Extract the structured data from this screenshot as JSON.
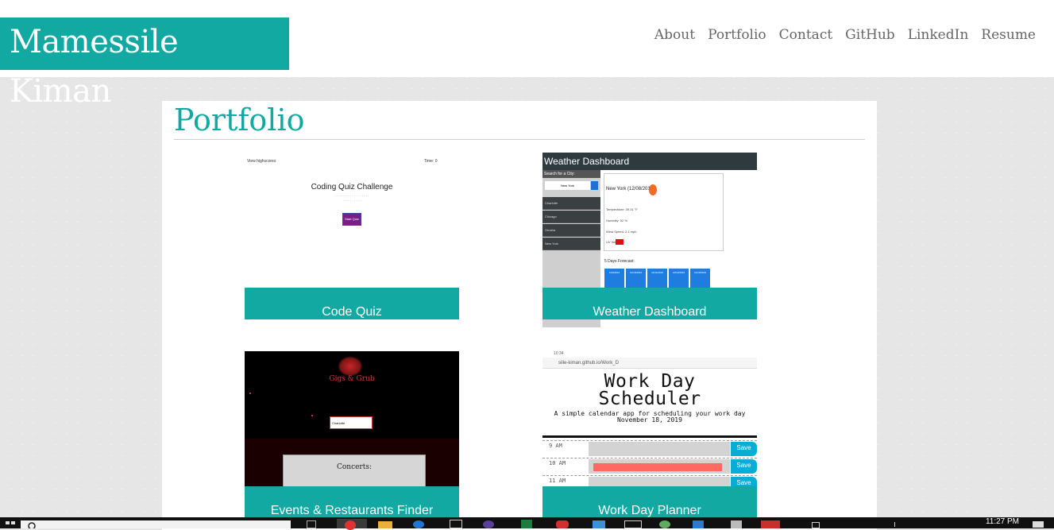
{
  "header": {
    "brand": "Mamessile Kiman",
    "nav": [
      "About",
      "Portfolio",
      "Contact",
      "GitHub",
      "LinkedIn",
      "Resume"
    ]
  },
  "portfolio": {
    "title": "Portfolio",
    "projects": [
      {
        "caption": "Code Quiz"
      },
      {
        "caption": "Weather Dashboard"
      },
      {
        "caption": "Events & Restaurants Finder"
      },
      {
        "caption": "Work Day Planner"
      }
    ]
  },
  "thumbs": {
    "quiz": {
      "highscores": "View highscores",
      "time": "Time: 0",
      "title": "Coding Quiz Challenge",
      "button": "Start Quiz"
    },
    "weather": {
      "title": "Weather Dashboard",
      "sidebar_header": "Search for a City:",
      "search_value": "New York",
      "cities": [
        "Charlotte",
        "Chicago",
        "Omaha",
        "New York"
      ],
      "current_city": "New York (12/08/2019)",
      "lines": [
        "Temperature: 39.31 °F",
        "Humidity: 52 %",
        "Wind Speed: 2.1 mph",
        "UV Index:"
      ],
      "forecast_label": "5 Days Forecast:",
      "forecast_dates": [
        "12/9/2019",
        "12/10/2019",
        "12/11/2019",
        "12/12/2019",
        "12/13/2019"
      ]
    },
    "events": {
      "logo_text": "Gigs & Grub",
      "input_value": "Charlotte",
      "panel_label": "Concerts:"
    },
    "workday": {
      "status": "10:34",
      "url": "siile-kiman.github.io/Work_D",
      "title_line1": "Work Day",
      "title_line2": "Scheduler",
      "subtitle": "A simple calendar app for scheduling your work day",
      "date": "November 18, 2019",
      "hours": [
        "9 AM",
        "10 AM",
        "11 AM"
      ],
      "save": "Save"
    }
  },
  "taskbar": {
    "clock": "11:27 PM"
  },
  "colors": {
    "accent": "#12a9a3",
    "nav_text": "#666666",
    "page_bg": "#e6e6e6"
  }
}
